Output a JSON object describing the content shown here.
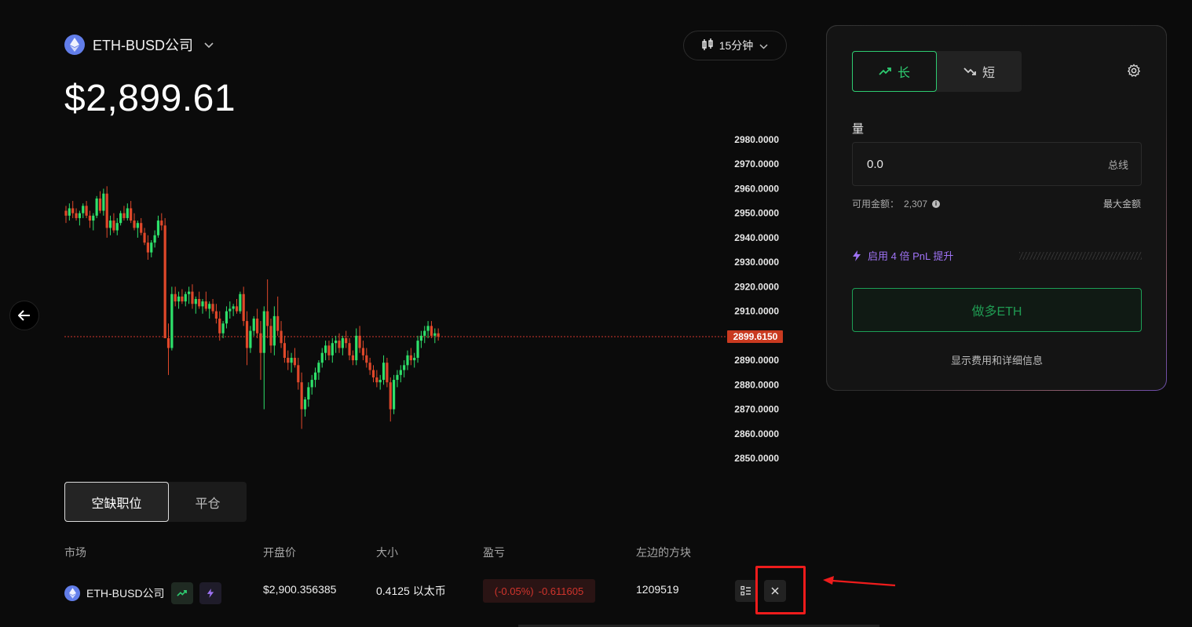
{
  "header": {
    "market": "ETH-BUSD公司",
    "price": "$2,899.61",
    "timeframe": "15分钟"
  },
  "chart_data": {
    "type": "candlestick",
    "y_ticks": [
      "2980.0000",
      "2970.0000",
      "2960.0000",
      "2950.0000",
      "2940.0000",
      "2930.0000",
      "2920.0000",
      "2910.0000",
      "2890.0000",
      "2880.0000",
      "2870.0000",
      "2860.0000",
      "2850.0000"
    ],
    "ylim": [
      2850,
      2980
    ],
    "current_price_label": "2899.6150",
    "current_price": 2899.615,
    "up_color": "#2ee06a",
    "down_color": "#e0482a",
    "candles": [
      [
        2951,
        2953,
        2946,
        2949
      ],
      [
        2949,
        2954,
        2947,
        2952
      ],
      [
        2952,
        2955,
        2948,
        2950
      ],
      [
        2950,
        2952,
        2947,
        2948
      ],
      [
        2948,
        2951,
        2945,
        2950
      ],
      [
        2950,
        2954,
        2948,
        2953
      ],
      [
        2953,
        2955,
        2948,
        2949
      ],
      [
        2949,
        2951,
        2944,
        2947
      ],
      [
        2947,
        2950,
        2943,
        2949
      ],
      [
        2949,
        2957,
        2948,
        2956
      ],
      [
        2956,
        2959,
        2950,
        2951
      ],
      [
        2951,
        2960,
        2949,
        2958
      ],
      [
        2958,
        2961,
        2940,
        2944
      ],
      [
        2944,
        2949,
        2941,
        2947
      ],
      [
        2947,
        2950,
        2942,
        2943
      ],
      [
        2943,
        2948,
        2941,
        2946
      ],
      [
        2946,
        2951,
        2945,
        2950
      ],
      [
        2950,
        2953,
        2947,
        2948
      ],
      [
        2948,
        2954,
        2947,
        2952
      ],
      [
        2952,
        2955,
        2946,
        2947
      ],
      [
        2947,
        2950,
        2943,
        2944
      ],
      [
        2944,
        2947,
        2940,
        2946
      ],
      [
        2946,
        2948,
        2941,
        2942
      ],
      [
        2942,
        2944,
        2937,
        2938
      ],
      [
        2938,
        2941,
        2931,
        2934
      ],
      [
        2934,
        2939,
        2932,
        2938
      ],
      [
        2938,
        2943,
        2936,
        2941
      ],
      [
        2941,
        2949,
        2940,
        2947
      ],
      [
        2947,
        2950,
        2943,
        2945
      ],
      [
        2945,
        2948,
        2938,
        2899
      ],
      [
        2899,
        2905,
        2884,
        2895
      ],
      [
        2895,
        2920,
        2894,
        2917
      ],
      [
        2917,
        2920,
        2912,
        2914
      ],
      [
        2914,
        2918,
        2911,
        2916
      ],
      [
        2916,
        2919,
        2913,
        2914
      ],
      [
        2914,
        2918,
        2912,
        2917
      ],
      [
        2917,
        2920,
        2913,
        2918
      ],
      [
        2918,
        2921,
        2911,
        2913
      ],
      [
        2913,
        2916,
        2909,
        2915
      ],
      [
        2915,
        2918,
        2911,
        2912
      ],
      [
        2912,
        2915,
        2909,
        2914
      ],
      [
        2914,
        2918,
        2910,
        2911
      ],
      [
        2911,
        2914,
        2907,
        2913
      ],
      [
        2913,
        2915,
        2909,
        2910
      ],
      [
        2910,
        2913,
        2905,
        2907
      ],
      [
        2907,
        2910,
        2898,
        2901
      ],
      [
        2901,
        2906,
        2899,
        2905
      ],
      [
        2905,
        2912,
        2903,
        2910
      ],
      [
        2910,
        2914,
        2907,
        2911
      ],
      [
        2911,
        2913,
        2908,
        2912
      ],
      [
        2912,
        2915,
        2909,
        2910
      ],
      [
        2910,
        2918,
        2909,
        2917
      ],
      [
        2917,
        2920,
        2904,
        2906
      ],
      [
        2906,
        2910,
        2888,
        2895
      ],
      [
        2895,
        2904,
        2893,
        2902
      ],
      [
        2902,
        2908,
        2900,
        2907
      ],
      [
        2907,
        2911,
        2899,
        2901
      ],
      [
        2901,
        2906,
        2882,
        2893
      ],
      [
        2893,
        2912,
        2870,
        2910
      ],
      [
        2910,
        2923,
        2899,
        2904
      ],
      [
        2904,
        2907,
        2893,
        2896
      ],
      [
        2896,
        2912,
        2892,
        2908
      ],
      [
        2908,
        2916,
        2900,
        2902
      ],
      [
        2902,
        2906,
        2895,
        2897
      ],
      [
        2897,
        2900,
        2889,
        2891
      ],
      [
        2891,
        2894,
        2886,
        2889
      ],
      [
        2889,
        2893,
        2885,
        2891
      ],
      [
        2891,
        2895,
        2887,
        2888
      ],
      [
        2888,
        2891,
        2878,
        2881
      ],
      [
        2881,
        2885,
        2862,
        2870
      ],
      [
        2870,
        2875,
        2867,
        2874
      ],
      [
        2874,
        2881,
        2871,
        2879
      ],
      [
        2879,
        2884,
        2876,
        2882
      ],
      [
        2882,
        2887,
        2879,
        2885
      ],
      [
        2885,
        2890,
        2882,
        2889
      ],
      [
        2889,
        2895,
        2887,
        2893
      ],
      [
        2893,
        2898,
        2890,
        2896
      ],
      [
        2896,
        2898,
        2890,
        2892
      ],
      [
        2892,
        2899,
        2889,
        2897
      ],
      [
        2897,
        2900,
        2893,
        2898
      ],
      [
        2898,
        2901,
        2893,
        2895
      ],
      [
        2895,
        2900,
        2892,
        2899
      ],
      [
        2899,
        2902,
        2895,
        2897
      ],
      [
        2897,
        2899,
        2890,
        2892
      ],
      [
        2892,
        2894,
        2888,
        2890
      ],
      [
        2890,
        2903,
        2888,
        2900
      ],
      [
        2900,
        2904,
        2893,
        2895
      ],
      [
        2895,
        2898,
        2890,
        2892
      ],
      [
        2892,
        2895,
        2887,
        2889
      ],
      [
        2889,
        2891,
        2884,
        2886
      ],
      [
        2886,
        2888,
        2881,
        2883
      ],
      [
        2883,
        2886,
        2879,
        2881
      ],
      [
        2881,
        2884,
        2878,
        2882
      ],
      [
        2882,
        2892,
        2880,
        2889
      ],
      [
        2889,
        2891,
        2879,
        2881
      ],
      [
        2881,
        2883,
        2865,
        2870
      ],
      [
        2870,
        2884,
        2868,
        2882
      ],
      [
        2882,
        2886,
        2879,
        2884
      ],
      [
        2884,
        2888,
        2881,
        2886
      ],
      [
        2886,
        2890,
        2883,
        2888
      ],
      [
        2888,
        2894,
        2886,
        2892
      ],
      [
        2892,
        2895,
        2888,
        2890
      ],
      [
        2890,
        2893,
        2887,
        2891
      ],
      [
        2891,
        2900,
        2889,
        2898
      ],
      [
        2898,
        2902,
        2895,
        2900
      ],
      [
        2900,
        2904,
        2897,
        2902
      ],
      [
        2902,
        2906,
        2899,
        2904
      ],
      [
        2904,
        2906,
        2899,
        2900
      ],
      [
        2900,
        2903,
        2897,
        2901
      ],
      [
        2901,
        2903,
        2898,
        2899.6
      ]
    ]
  },
  "order_panel": {
    "long_label": "长",
    "short_label": "短",
    "amount_label": "量",
    "amount_value": "0.0",
    "amount_unit": "总线",
    "available_label": "可用金额：",
    "available_value": "2,307",
    "max_label": "最大金额",
    "boost_label": "启用 4 倍 PnL 提升",
    "submit_label": "做多ETH",
    "fee_link": "显示费用和详细信息"
  },
  "positions": {
    "tabs": [
      "空缺职位",
      "平仓"
    ],
    "headers": [
      "市场",
      "开盘价",
      "大小",
      "盈亏",
      "左边的方块"
    ],
    "rows": [
      {
        "market": "ETH-BUSD公司",
        "open_price": "$2,900.356385",
        "size": "0.4125 以太币",
        "pnl_pct": "(-0.05%)",
        "pnl_value": "-0.611605",
        "block": "1209519"
      }
    ]
  }
}
